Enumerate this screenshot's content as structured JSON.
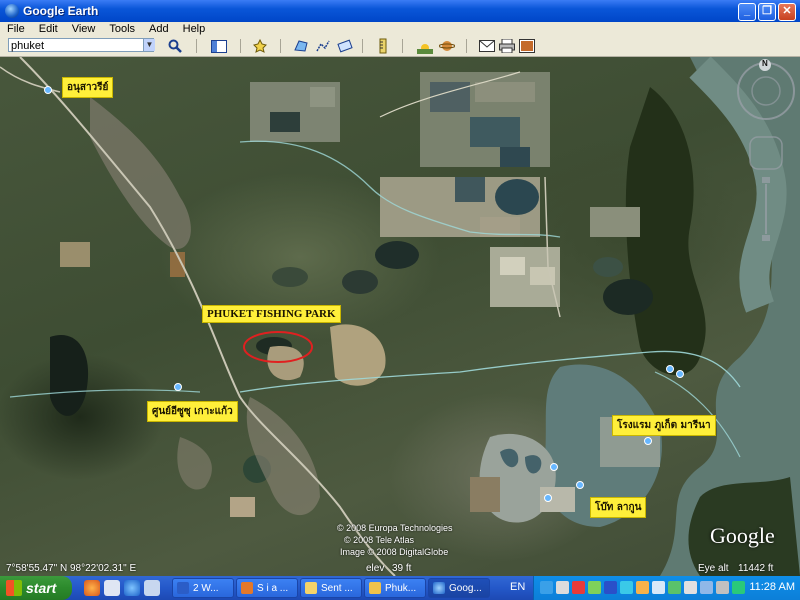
{
  "window": {
    "title": "Google Earth"
  },
  "menu": [
    "File",
    "Edit",
    "View",
    "Tools",
    "Add",
    "Help"
  ],
  "search": {
    "value": "phuket"
  },
  "map": {
    "labels": {
      "anusawari": "อนุสาวรีย์",
      "fishing_park": "PHUKET FISHING PARK",
      "center": "ศูนย์อีซูซุ เกาะแก้ว",
      "hotel": "โรงแรม ภูเก็ต มารีนา",
      "boat": "โบ๊ท ลากูน"
    },
    "copyright": [
      "© 2008 Europa Technologies",
      "© 2008 Tele Atlas",
      "Image © 2008 DigitalGlobe"
    ],
    "logo": "Google",
    "compass_letter": "N"
  },
  "status": {
    "coords": "7°58'55.47\" N    98°22'02.31\" E",
    "elev_label": "elev",
    "elev_value": "39 ft",
    "eye_label": "Eye alt",
    "eye_value": "11442 ft"
  },
  "taskbar": {
    "start": "start",
    "tasks": [
      "2 W...",
      "S i a ...",
      "Sent ...",
      "Phuk...",
      "Goog..."
    ],
    "lang": "EN",
    "clock": "11:28 AM"
  }
}
